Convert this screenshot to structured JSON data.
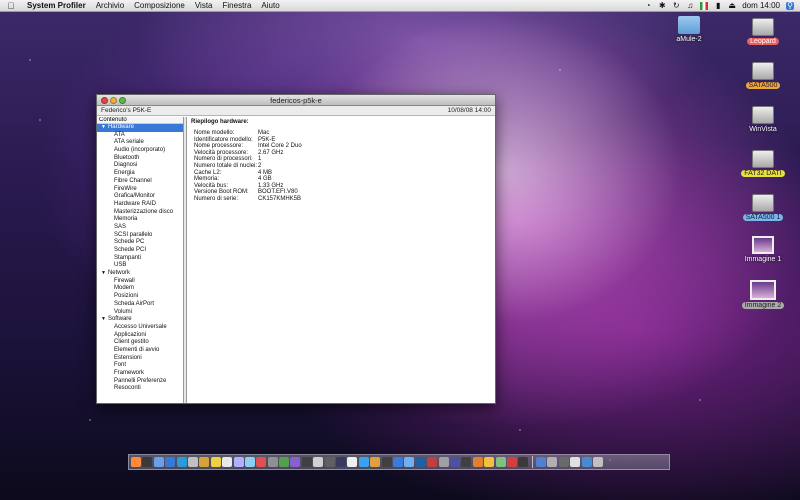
{
  "menubar": {
    "apple": "",
    "app_name": "System Profiler",
    "items": [
      "Archivio",
      "Composizione",
      "Vista",
      "Finestra",
      "Aiuto"
    ],
    "clock": "dom 14:00"
  },
  "desktop_icons": [
    {
      "label": "aMule-2",
      "style": "folder",
      "label_color": "none"
    },
    {
      "label": "Leopard",
      "style": "drive",
      "label_color": "red"
    },
    {
      "label": "SATA500",
      "style": "drive",
      "label_color": "orange"
    },
    {
      "label": "WinVista",
      "style": "drive",
      "label_color": "none"
    },
    {
      "label": "FAT32 DATI",
      "style": "drive",
      "label_color": "yellow"
    },
    {
      "label": "SATA500 1",
      "style": "drive",
      "label_color": "blue"
    },
    {
      "label": "Immagine 1",
      "style": "pic",
      "label_color": "none"
    },
    {
      "label": "Immagine 2",
      "style": "pic",
      "label_color": "gray"
    }
  ],
  "window": {
    "title": "federicos-p5k-e",
    "computer_name": "Federico's P5K-E",
    "date": "10/08/08 14:00",
    "sidebar_header": "Contenuto",
    "sidebar": [
      {
        "label": "Hardware",
        "type": "cat",
        "selected": true
      },
      {
        "label": "ATA",
        "type": "sub"
      },
      {
        "label": "ATA seriale",
        "type": "sub"
      },
      {
        "label": "Audio (incorporato)",
        "type": "sub"
      },
      {
        "label": "Bluetooth",
        "type": "sub"
      },
      {
        "label": "Diagnosi",
        "type": "sub"
      },
      {
        "label": "Energia",
        "type": "sub"
      },
      {
        "label": "Fibre Channel",
        "type": "sub"
      },
      {
        "label": "FireWire",
        "type": "sub"
      },
      {
        "label": "Grafica/Monitor",
        "type": "sub"
      },
      {
        "label": "Hardware RAID",
        "type": "sub"
      },
      {
        "label": "Masterizzazione disco",
        "type": "sub"
      },
      {
        "label": "Memoria",
        "type": "sub"
      },
      {
        "label": "SAS",
        "type": "sub"
      },
      {
        "label": "SCSI parallelo",
        "type": "sub"
      },
      {
        "label": "Schede PC",
        "type": "sub"
      },
      {
        "label": "Schede PCI",
        "type": "sub"
      },
      {
        "label": "Stampanti",
        "type": "sub"
      },
      {
        "label": "USB",
        "type": "sub"
      },
      {
        "label": "Network",
        "type": "cat"
      },
      {
        "label": "Firewall",
        "type": "sub"
      },
      {
        "label": "Modem",
        "type": "sub"
      },
      {
        "label": "Posizioni",
        "type": "sub"
      },
      {
        "label": "Scheda AirPort",
        "type": "sub"
      },
      {
        "label": "Volumi",
        "type": "sub"
      },
      {
        "label": "Software",
        "type": "cat"
      },
      {
        "label": "Accesso Universale",
        "type": "sub"
      },
      {
        "label": "Applicazioni",
        "type": "sub"
      },
      {
        "label": "Client gestito",
        "type": "sub"
      },
      {
        "label": "Elementi di avvio",
        "type": "sub"
      },
      {
        "label": "Estensioni",
        "type": "sub"
      },
      {
        "label": "Font",
        "type": "sub"
      },
      {
        "label": "Framework",
        "type": "sub"
      },
      {
        "label": "Pannelli Preferenze",
        "type": "sub"
      },
      {
        "label": "Resoconti",
        "type": "sub"
      }
    ],
    "main_title": "Riepilogo hardware:",
    "specs": [
      {
        "k": "Nome modello:",
        "v": "Mac"
      },
      {
        "k": "Identificatore modello:",
        "v": "P5K-E"
      },
      {
        "k": "Nome processore:",
        "v": "Intel Core 2 Duo"
      },
      {
        "k": "Velocità processore:",
        "v": "2.67 GHz"
      },
      {
        "k": "Numero di processori:",
        "v": "1"
      },
      {
        "k": "Numero totale di nuclei:",
        "v": "2"
      },
      {
        "k": "Cache L2:",
        "v": "4 MB"
      },
      {
        "k": "Memoria:",
        "v": "4 GB"
      },
      {
        "k": "Velocità bus:",
        "v": "1.33 GHz"
      },
      {
        "k": "Versione Boot ROM:",
        "v": "BOOT.EFI.V80"
      },
      {
        "k": "Numero di serie:",
        "v": "CK157KMHK5B"
      }
    ]
  },
  "dock_colors": [
    "#ff8a3a",
    "#3a3a3a",
    "#6aa0e8",
    "#3a78d8",
    "#2a9ad8",
    "#c0c0c0",
    "#d8a23a",
    "#f0d040",
    "#e8e8e8",
    "#b0b0ff",
    "#8ad0f0",
    "#e05050",
    "#909090",
    "#50a050",
    "#8a60d0",
    "#404040",
    "#d0d0d0",
    "#606060",
    "#3a3a60",
    "#f0f0f0",
    "#3aa0f0",
    "#e0a040",
    "#404040",
    "#3a7ad8",
    "#70b0f0",
    "#2060a0",
    "#c04040",
    "#a0a0a0",
    "#5050a0",
    "#404040",
    "#e08030",
    "#f0c040",
    "#80c080",
    "#d04040",
    "#3a3a3a",
    "#5080d0",
    "#b0b0b0",
    "#6a6a6a",
    "#e0e0e0",
    "#4a8ad0",
    "#c0c0c0"
  ]
}
